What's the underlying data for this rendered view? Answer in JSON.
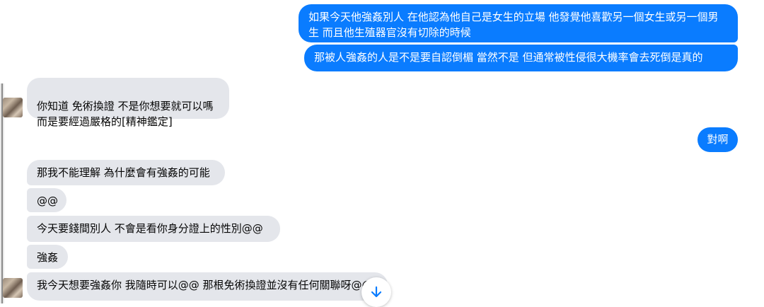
{
  "conversation": {
    "messages": [
      {
        "from": "me",
        "text": "如果今天他強姦別人  在他認為他自己是女生的立場 他發覺他喜歡另一個女生或另一個男生  而且他生殖器官沒有切除的時候"
      },
      {
        "from": "me",
        "text": "那被人強姦的人是不是要自認倒楣   當然不是  但通常被性侵很大機率會去死倒是真的"
      },
      {
        "from": "them",
        "text": "你知道 免術換證 不是你想要就可以嗎\n而是要經過嚴格的[精神鑑定]"
      },
      {
        "from": "me",
        "text": "對啊"
      },
      {
        "from": "them",
        "text": "那我不能理解 為什麼會有強姦的可能"
      },
      {
        "from": "them",
        "text": "@@"
      },
      {
        "from": "them",
        "text": "今天要錢間別人 不會是看你身分證上的性別@@"
      },
      {
        "from": "them",
        "text": "強姦"
      },
      {
        "from": "them",
        "text": "我今天想要強姦你 我隨時可以@@ 那根免術換證並沒有任何關聯呀@@"
      }
    ]
  },
  "colors": {
    "outgoing_bubble": "#0a7cff",
    "incoming_bubble": "#e4e6eb",
    "background": "#ffffff"
  },
  "icons": {
    "scroll_down": "arrow-down-icon",
    "avatar": "contact-avatar"
  }
}
